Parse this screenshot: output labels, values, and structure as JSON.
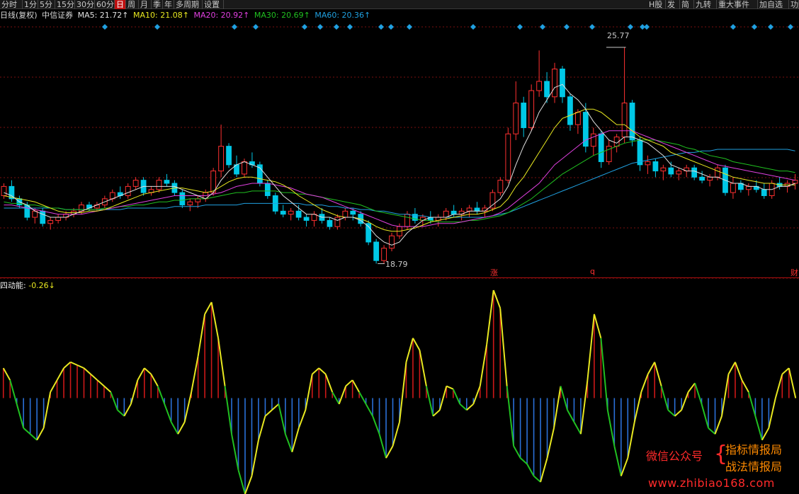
{
  "toolbar": {
    "left_items": [
      "分时",
      "1分",
      "5分",
      "15分",
      "30分",
      "60分",
      "日",
      "周",
      "月",
      "季",
      "年",
      "多周期",
      "设置"
    ],
    "active_item": "日",
    "right_items": [
      "H股",
      "发",
      "简",
      "九转",
      "重大事件",
      "加自选",
      "功"
    ]
  },
  "legend": {
    "title": "日线(复权)",
    "stock": "中信证券",
    "ma": [
      {
        "label": "MA5: 21.72↑",
        "color": "#e0e0e0"
      },
      {
        "label": "MA10: 21.08↑",
        "color": "#e8e820"
      },
      {
        "label": "MA20: 20.92↑",
        "color": "#e040e0"
      },
      {
        "label": "MA30: 20.69↑",
        "color": "#20c020"
      },
      {
        "label": "MA60: 20.36↑",
        "color": "#20a0e0"
      }
    ]
  },
  "price_labels": {
    "high": "25.77",
    "low": "18.79"
  },
  "event_marks": [
    "涨",
    "q",
    "财"
  ],
  "indicator": {
    "name": "四动能:",
    "value": "-0.26↓"
  },
  "watermark": {
    "left": "微信公众号",
    "right_line1": "指标情报局",
    "right_line2": "战法情报局",
    "url": "www.zhibiao168.com"
  },
  "colors": {
    "up": "#ff3030",
    "down": "#00c8e6",
    "macd_red": "#cc1818",
    "macd_blue": "#2a70d8",
    "macd_line": "#e8e820",
    "macd_green": "#20c020",
    "grid": "#7a1010"
  },
  "chart_data": {
    "type": "candlestick",
    "ylim": [
      18.4,
      26.6
    ],
    "candles": [
      [
        21.0,
        21.4,
        20.9,
        21.3
      ],
      [
        21.3,
        21.5,
        20.8,
        20.9
      ],
      [
        20.9,
        21.0,
        20.6,
        20.7
      ],
      [
        20.7,
        20.8,
        20.2,
        20.3
      ],
      [
        20.3,
        20.6,
        20.1,
        20.5
      ],
      [
        20.5,
        20.6,
        20.0,
        20.1
      ],
      [
        20.1,
        20.3,
        19.9,
        20.2
      ],
      [
        20.2,
        20.4,
        20.1,
        20.3
      ],
      [
        20.3,
        20.5,
        20.2,
        20.4
      ],
      [
        20.4,
        20.6,
        20.3,
        20.5
      ],
      [
        20.5,
        20.8,
        20.4,
        20.7
      ],
      [
        20.7,
        20.8,
        20.5,
        20.6
      ],
      [
        20.6,
        20.8,
        20.5,
        20.7
      ],
      [
        20.7,
        21.0,
        20.6,
        20.9
      ],
      [
        20.9,
        21.2,
        20.8,
        21.1
      ],
      [
        21.1,
        21.3,
        20.9,
        21.0
      ],
      [
        21.0,
        21.4,
        20.9,
        21.3
      ],
      [
        21.3,
        21.6,
        21.2,
        21.5
      ],
      [
        21.5,
        21.6,
        21.0,
        21.1
      ],
      [
        21.1,
        21.3,
        21.0,
        21.2
      ],
      [
        21.2,
        21.6,
        21.1,
        21.5
      ],
      [
        21.5,
        21.7,
        21.3,
        21.4
      ],
      [
        21.4,
        21.5,
        21.0,
        21.1
      ],
      [
        21.1,
        21.2,
        20.6,
        20.7
      ],
      [
        20.7,
        20.9,
        20.5,
        20.8
      ],
      [
        20.8,
        21.0,
        20.6,
        20.9
      ],
      [
        20.9,
        21.2,
        20.8,
        21.1
      ],
      [
        21.1,
        21.9,
        21.0,
        21.8
      ],
      [
        21.8,
        23.3,
        21.6,
        22.6
      ],
      [
        22.6,
        22.7,
        21.9,
        22.0
      ],
      [
        22.0,
        22.3,
        21.6,
        21.7
      ],
      [
        21.7,
        22.2,
        21.6,
        22.1
      ],
      [
        22.1,
        22.4,
        21.9,
        22.0
      ],
      [
        22.0,
        22.1,
        21.3,
        21.4
      ],
      [
        21.4,
        21.5,
        20.9,
        21.0
      ],
      [
        21.0,
        21.1,
        20.4,
        20.5
      ],
      [
        20.5,
        20.7,
        20.3,
        20.4
      ],
      [
        20.4,
        20.6,
        20.2,
        20.5
      ],
      [
        20.5,
        20.7,
        20.2,
        20.3
      ],
      [
        20.3,
        20.4,
        20.0,
        20.2
      ],
      [
        20.2,
        20.5,
        20.0,
        20.4
      ],
      [
        20.4,
        20.6,
        20.1,
        20.2
      ],
      [
        20.2,
        20.3,
        19.9,
        20.0
      ],
      [
        20.0,
        20.4,
        19.9,
        20.3
      ],
      [
        20.3,
        20.6,
        20.2,
        20.5
      ],
      [
        20.5,
        20.6,
        20.2,
        20.4
      ],
      [
        20.4,
        20.5,
        20.0,
        20.1
      ],
      [
        20.1,
        20.2,
        19.4,
        19.5
      ],
      [
        19.5,
        19.6,
        18.8,
        18.9
      ],
      [
        18.9,
        19.4,
        18.8,
        19.3
      ],
      [
        19.3,
        19.8,
        19.2,
        19.7
      ],
      [
        19.7,
        20.1,
        19.6,
        20.0
      ],
      [
        20.0,
        20.5,
        19.9,
        20.4
      ],
      [
        20.4,
        20.6,
        20.1,
        20.2
      ],
      [
        20.2,
        20.4,
        20.0,
        20.3
      ],
      [
        20.3,
        20.5,
        20.1,
        20.2
      ],
      [
        20.2,
        20.4,
        20.0,
        20.3
      ],
      [
        20.3,
        20.6,
        20.2,
        20.5
      ],
      [
        20.5,
        20.7,
        20.3,
        20.4
      ],
      [
        20.4,
        20.6,
        20.2,
        20.5
      ],
      [
        20.5,
        20.7,
        20.3,
        20.6
      ],
      [
        20.6,
        20.8,
        20.4,
        20.5
      ],
      [
        20.5,
        20.7,
        20.3,
        20.6
      ],
      [
        20.6,
        21.2,
        20.5,
        21.1
      ],
      [
        21.1,
        21.6,
        21.0,
        21.5
      ],
      [
        21.5,
        23.2,
        21.4,
        23.0
      ],
      [
        23.0,
        24.7,
        22.8,
        24.0
      ],
      [
        24.0,
        24.2,
        22.9,
        23.2
      ],
      [
        23.2,
        24.6,
        23.1,
        24.4
      ],
      [
        24.4,
        25.7,
        24.2,
        24.7
      ],
      [
        24.7,
        25.0,
        24.0,
        24.2
      ],
      [
        24.2,
        25.3,
        24.0,
        25.1
      ],
      [
        25.1,
        25.2,
        24.0,
        24.2
      ],
      [
        24.2,
        24.3,
        23.1,
        23.3
      ],
      [
        23.3,
        23.8,
        23.0,
        23.7
      ],
      [
        23.7,
        24.0,
        22.4,
        22.6
      ],
      [
        22.6,
        23.2,
        22.3,
        23.0
      ],
      [
        23.0,
        23.1,
        21.9,
        22.1
      ],
      [
        22.1,
        22.8,
        22.0,
        22.6
      ],
      [
        22.6,
        23.0,
        22.4,
        22.9
      ],
      [
        22.9,
        25.8,
        22.7,
        24.0
      ],
      [
        24.0,
        24.1,
        22.6,
        22.8
      ],
      [
        22.8,
        22.9,
        21.8,
        22.0
      ],
      [
        22.0,
        22.3,
        21.7,
        22.1
      ],
      [
        22.1,
        22.2,
        21.6,
        21.8
      ],
      [
        21.8,
        22.0,
        21.5,
        21.9
      ],
      [
        21.9,
        22.1,
        21.6,
        21.7
      ],
      [
        21.7,
        21.9,
        21.5,
        21.8
      ],
      [
        21.8,
        22.0,
        21.6,
        21.9
      ],
      [
        21.9,
        22.0,
        21.5,
        21.6
      ],
      [
        21.6,
        21.8,
        21.4,
        21.5
      ],
      [
        21.5,
        21.7,
        21.3,
        21.6
      ],
      [
        21.6,
        22.0,
        21.5,
        21.9
      ],
      [
        21.9,
        22.0,
        21.0,
        21.1
      ],
      [
        21.1,
        21.6,
        20.9,
        21.4
      ],
      [
        21.4,
        21.5,
        21.1,
        21.2
      ],
      [
        21.2,
        21.4,
        21.0,
        21.3
      ],
      [
        21.3,
        21.5,
        21.1,
        21.2
      ],
      [
        21.2,
        21.4,
        20.9,
        21.0
      ],
      [
        21.0,
        21.5,
        20.9,
        21.4
      ],
      [
        21.4,
        21.6,
        21.2,
        21.3
      ],
      [
        21.3,
        21.5,
        21.1,
        21.4
      ],
      [
        21.4,
        21.7,
        21.2,
        21.5
      ]
    ],
    "ma5": [
      21.1,
      21.0,
      20.8,
      20.7,
      20.5,
      20.4,
      20.3,
      20.3,
      20.3,
      20.4,
      20.5,
      20.6,
      20.7,
      20.8,
      20.9,
      21.0,
      21.1,
      21.2,
      21.3,
      21.3,
      21.3,
      21.3,
      21.3,
      21.2,
      21.1,
      21.0,
      20.9,
      21.1,
      21.5,
      21.8,
      22.0,
      22.1,
      22.0,
      21.9,
      21.6,
      21.3,
      21.0,
      20.8,
      20.6,
      20.4,
      20.4,
      20.3,
      20.3,
      20.2,
      20.3,
      20.3,
      20.2,
      20.0,
      19.7,
      19.5,
      19.4,
      19.5,
      19.8,
      20.0,
      20.2,
      20.3,
      20.3,
      20.3,
      20.4,
      20.4,
      20.5,
      20.5,
      20.5,
      20.7,
      20.9,
      21.3,
      22.0,
      22.6,
      23.1,
      23.7,
      24.1,
      24.5,
      24.6,
      24.3,
      24.1,
      23.8,
      23.4,
      23.1,
      22.8,
      22.7,
      22.9,
      22.9,
      22.8,
      22.7,
      22.5,
      22.3,
      22.0,
      21.9,
      21.8,
      21.8,
      21.7,
      21.6,
      21.6,
      21.5,
      21.4,
      21.4,
      21.3,
      21.3,
      21.2,
      21.2,
      21.3,
      21.3,
      21.4
    ],
    "ma10": [
      21.0,
      20.95,
      20.9,
      20.85,
      20.8,
      20.7,
      20.6,
      20.5,
      20.45,
      20.45,
      20.45,
      20.5,
      20.5,
      20.55,
      20.65,
      20.75,
      20.85,
      20.95,
      21.05,
      21.1,
      21.15,
      21.2,
      21.25,
      21.25,
      21.2,
      21.15,
      21.1,
      21.15,
      21.3,
      21.45,
      21.55,
      21.6,
      21.6,
      21.55,
      21.5,
      21.45,
      21.35,
      21.2,
      21.0,
      20.85,
      20.7,
      20.55,
      20.45,
      20.35,
      20.3,
      20.3,
      20.25,
      20.15,
      20.0,
      19.9,
      19.85,
      19.85,
      19.9,
      19.95,
      20.05,
      20.15,
      20.2,
      20.25,
      20.3,
      20.35,
      20.4,
      20.4,
      20.45,
      20.55,
      20.65,
      20.9,
      21.3,
      21.6,
      22.0,
      22.4,
      22.8,
      23.2,
      23.5,
      23.6,
      23.7,
      23.8,
      23.8,
      23.7,
      23.5,
      23.3,
      23.3,
      23.1,
      22.9,
      22.8,
      22.7,
      22.6,
      22.4,
      22.3,
      22.2,
      22.1,
      22.0,
      21.9,
      21.8,
      21.7,
      21.6,
      21.55,
      21.5,
      21.45,
      21.4,
      21.4,
      21.35,
      21.35,
      21.35
    ],
    "ma20": [
      20.7,
      20.7,
      20.65,
      20.6,
      20.55,
      20.5,
      20.45,
      20.4,
      20.4,
      20.4,
      20.4,
      20.45,
      20.5,
      20.55,
      20.6,
      20.65,
      20.7,
      20.75,
      20.8,
      20.85,
      20.9,
      20.95,
      21.0,
      21.0,
      21.0,
      21.0,
      21.0,
      21.05,
      21.1,
      21.2,
      21.3,
      21.35,
      21.4,
      21.4,
      21.4,
      21.35,
      21.3,
      21.25,
      21.15,
      21.05,
      21.0,
      20.95,
      20.85,
      20.75,
      20.65,
      20.55,
      20.45,
      20.35,
      20.25,
      20.15,
      20.05,
      20.0,
      20.0,
      20.0,
      20.0,
      20.05,
      20.1,
      20.1,
      20.1,
      20.15,
      20.2,
      20.25,
      20.3,
      20.35,
      20.45,
      20.6,
      20.8,
      21.0,
      21.2,
      21.4,
      21.7,
      22.0,
      22.2,
      22.4,
      22.6,
      22.8,
      22.9,
      23.0,
      23.1,
      23.1,
      23.1,
      23.1,
      23.0,
      22.9,
      22.8,
      22.7,
      22.6,
      22.5,
      22.4,
      22.3,
      22.2,
      22.1,
      22.0,
      21.95,
      21.9,
      21.85,
      21.8,
      21.75,
      21.7,
      21.65,
      21.6,
      21.55,
      21.5
    ],
    "ma30": [
      20.8,
      20.75,
      20.75,
      20.7,
      20.7,
      20.65,
      20.6,
      20.6,
      20.55,
      20.55,
      20.55,
      20.55,
      20.55,
      20.6,
      20.6,
      20.65,
      20.65,
      20.7,
      20.7,
      20.75,
      20.8,
      20.8,
      20.85,
      20.85,
      20.9,
      20.9,
      20.9,
      20.95,
      21.0,
      21.05,
      21.1,
      21.1,
      21.15,
      21.15,
      21.15,
      21.15,
      21.1,
      21.1,
      21.05,
      21.05,
      21.0,
      20.95,
      20.9,
      20.85,
      20.8,
      20.75,
      20.7,
      20.6,
      20.5,
      20.45,
      20.4,
      20.35,
      20.3,
      20.25,
      20.2,
      20.2,
      20.15,
      20.15,
      20.15,
      20.15,
      20.2,
      20.2,
      20.25,
      20.3,
      20.35,
      20.45,
      20.6,
      20.75,
      20.9,
      21.1,
      21.3,
      21.5,
      21.7,
      21.85,
      22.0,
      22.15,
      22.3,
      22.4,
      22.5,
      22.6,
      22.7,
      22.75,
      22.8,
      22.8,
      22.8,
      22.75,
      22.7,
      22.65,
      22.55,
      22.5,
      22.4,
      22.3,
      22.25,
      22.2,
      22.1,
      22.05,
      22.0,
      21.95,
      21.9,
      21.85,
      21.8,
      21.8,
      21.75
    ],
    "ma60": [
      20.6,
      20.6,
      20.6,
      20.6,
      20.6,
      20.6,
      20.6,
      20.6,
      20.55,
      20.55,
      20.55,
      20.55,
      20.55,
      20.55,
      20.55,
      20.55,
      20.6,
      20.6,
      20.6,
      20.6,
      20.6,
      20.6,
      20.65,
      20.65,
      20.65,
      20.65,
      20.7,
      20.7,
      20.7,
      20.7,
      20.7,
      20.75,
      20.75,
      20.75,
      20.75,
      20.75,
      20.75,
      20.75,
      20.75,
      20.7,
      20.7,
      20.7,
      20.65,
      20.65,
      20.6,
      20.6,
      20.55,
      20.55,
      20.5,
      20.5,
      20.45,
      20.4,
      20.4,
      20.35,
      20.35,
      20.3,
      20.3,
      20.3,
      20.3,
      20.3,
      20.3,
      20.3,
      20.3,
      20.35,
      20.4,
      20.45,
      20.55,
      20.65,
      20.75,
      20.85,
      20.95,
      21.05,
      21.15,
      21.25,
      21.35,
      21.45,
      21.55,
      21.65,
      21.75,
      21.85,
      21.95,
      22.05,
      22.1,
      22.15,
      22.2,
      22.25,
      22.3,
      22.35,
      22.4,
      22.4,
      22.45,
      22.45,
      22.5,
      22.5,
      22.5,
      22.5,
      22.5,
      22.5,
      22.5,
      22.5,
      22.5,
      22.5,
      22.45
    ],
    "indicator": {
      "ylim": [
        -1.6,
        1.8
      ],
      "values": [
        0.5,
        0.3,
        -0.1,
        -0.5,
        -0.6,
        -0.7,
        -0.5,
        0.1,
        0.3,
        0.5,
        0.6,
        0.55,
        0.5,
        0.4,
        0.3,
        0.2,
        0.1,
        -0.2,
        -0.3,
        -0.1,
        0.3,
        0.5,
        0.4,
        0.2,
        -0.1,
        -0.4,
        -0.6,
        -0.4,
        0.1,
        0.7,
        1.4,
        1.6,
        1.0,
        0.2,
        -0.6,
        -1.2,
        -1.6,
        -1.3,
        -0.7,
        -0.3,
        -0.2,
        -0.1,
        -0.6,
        -0.9,
        -0.5,
        -0.2,
        0.4,
        0.5,
        0.4,
        0.1,
        -0.1,
        0.2,
        0.3,
        0.1,
        -0.1,
        -0.3,
        -0.6,
        -1.0,
        -0.8,
        -0.4,
        0.6,
        1.0,
        0.8,
        0.2,
        -0.3,
        -0.2,
        0.2,
        0.15,
        -0.1,
        -0.2,
        -0.1,
        0.2,
        0.9,
        1.8,
        1.5,
        0.2,
        -0.8,
        -1.0,
        -1.1,
        -1.3,
        -1.4,
        -1.0,
        -0.5,
        0.2,
        -0.2,
        -0.4,
        -0.6,
        0.3,
        1.4,
        1.0,
        -0.2,
        -0.8,
        -1.3,
        -1.0,
        -0.4,
        0.1,
        0.4,
        0.6,
        0.2,
        -0.2,
        -0.3,
        -0.2,
        0.1,
        0.25,
        -0.1,
        -0.5,
        -0.6,
        -0.3,
        0.4,
        0.6,
        0.3,
        0.1,
        -0.3,
        -0.7,
        -0.5,
        0.0,
        0.4,
        0.5,
        0.0
      ]
    }
  }
}
